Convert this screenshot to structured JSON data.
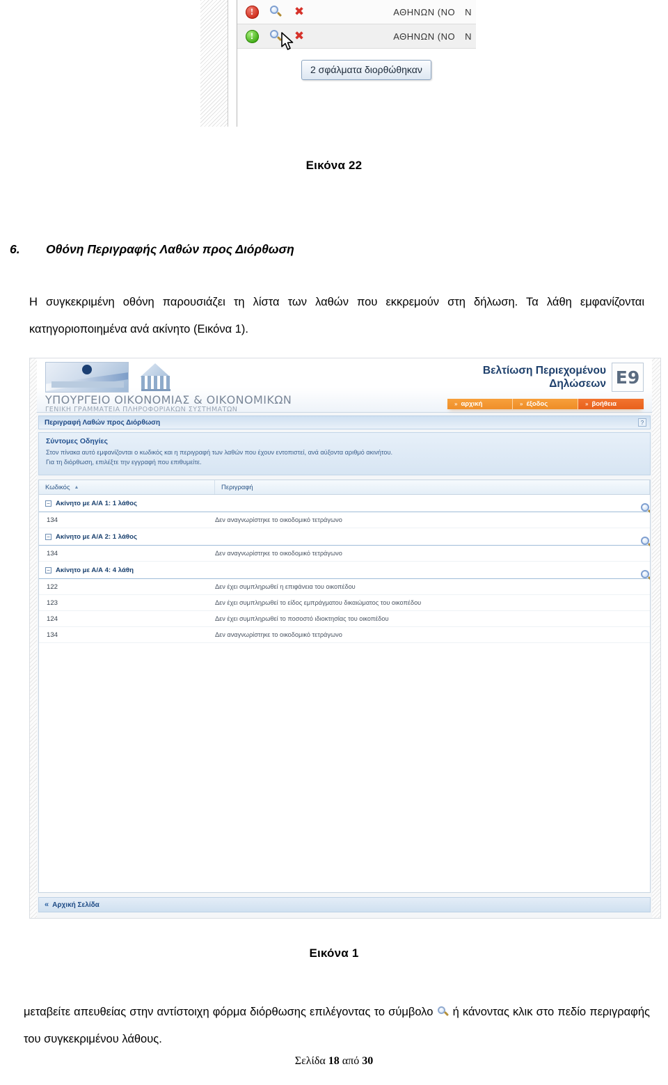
{
  "figure22": {
    "rows": [
      {
        "status_icon": "error-circle-red",
        "search_icon": "magnifier-icon",
        "delete_icon": "delete-x-icon",
        "col1": "ΑΘΗΝΩΝ (ΝΟ",
        "col2": "Ν"
      },
      {
        "status_icon": "ok-circle-green",
        "search_icon": "magnifier-icon",
        "delete_icon": "delete-x-icon",
        "col1": "ΑΘΗΝΩΝ (ΝΟ",
        "col2": "Ν"
      }
    ],
    "tooltip": "2 σφάλματα διορθώθηκαν",
    "cursor_icon": "mouse-pointer-icon"
  },
  "caption_22": "Εικόνα 22",
  "caption_1": "Εικόνα 1",
  "section": {
    "number": "6.",
    "title": "Οθόνη Περιγραφής Λαθών προς Διόρθωση"
  },
  "paragraph_1": "Η συγκεκριμένη οθόνη παρουσιάζει τη λίστα των λαθών που εκκρεμούν στη δήλωση. Τα λάθη εμφανίζονται κατηγοριοποιημένα ανά ακίνητο (Εικόνα 1).",
  "paragraph_2": {
    "before": "μεταβείτε απευθείας στην αντίστοιχη φόρμα διόρθωσης επιλέγοντας το σύμβολο",
    "after": "ή κάνοντας κλικ στο πεδίο περιγραφής του συγκεκριμένου λάθους."
  },
  "page_footer": {
    "prefix": "Σελίδα",
    "current": "18",
    "middle": "από",
    "total": "30"
  },
  "app": {
    "ministry_title": "ΥΠΟΥΡΓΕΙΟ ΟΙΚΟΝΟΜΙΑΣ & ΟΙΚΟΝΟΜΙΚΩΝ",
    "ministry_sub": "ΓΕΝΙΚΗ ΓΡΑΜΜΑΤΕΙΑ ΠΛΗΡΟΦΟΡΙΑΚΩΝ ΣΥΣΤΗΜΑΤΩΝ",
    "app_title_line1": "Βελτίωση Περιεχομένου",
    "app_title_line2": "Δηλώσεων",
    "badge": "E9",
    "nav": [
      {
        "chev": "»",
        "label": "αρχική"
      },
      {
        "chev": "»",
        "label": "έξοδος"
      },
      {
        "chev": "»",
        "label": "βοήθεια"
      }
    ],
    "page_tab_title": "Περιγραφή Λαθών προς Διόρθωση",
    "help_icon": "question-mark-icon",
    "instructions": {
      "title": "Σύντομες Οδηγίες",
      "line1": "Στον πίνακα αυτό εμφανίζονται ο κωδικός και η περιγραφή των λαθών που έχουν εντοπιστεί, ανά αύξοντα αριθμό ακινήτου.",
      "line2": "Για τη διόρθωση, επιλέξτε την εγγραφή που επιθυμείτε."
    },
    "grid": {
      "headers": [
        "Κωδικός",
        "Περιγραφή"
      ],
      "sort_indicator": "▲",
      "groups": [
        {
          "label": "Ακίνητο με Α/Α 1: 1 λάθος",
          "expander": "−",
          "magnifier_icon": "magnifier-icon",
          "rows": [
            {
              "code": "134",
              "description": "Δεν αναγνωρίστηκε το οικοδομικό τετράγωνο"
            }
          ]
        },
        {
          "label": "Ακίνητο με Α/Α 2: 1 λάθος",
          "expander": "−",
          "magnifier_icon": "magnifier-icon",
          "rows": [
            {
              "code": "134",
              "description": "Δεν αναγνωρίστηκε το οικοδομικό τετράγωνο"
            }
          ]
        },
        {
          "label": "Ακίνητο με Α/Α 4: 4 λάθη",
          "expander": "−",
          "magnifier_icon": "magnifier-icon",
          "rows": [
            {
              "code": "122",
              "description": "Δεν έχει συμπληρωθεί η επιφάνεια του οικοπέδου"
            },
            {
              "code": "123",
              "description": "Δεν έχει συμπληρωθεί το είδος εμπράγματου δικαιώματος του οικοπέδου"
            },
            {
              "code": "124",
              "description": "Δεν έχει συμπληρωθεί το ποσοστό ιδιοκτησίας του οικοπέδου"
            },
            {
              "code": "134",
              "description": "Δεν αναγνωρίστηκε το οικοδομικό τετράγωνο"
            }
          ]
        }
      ]
    },
    "footer_link": "Αρχική Σελίδα",
    "footer_icon": "double-chevron-left-icon"
  },
  "colors": {
    "accent_orange": "#ef8f2a",
    "accent_orange_dark": "#e8611c",
    "header_blue": "#1d3f6b",
    "grid_border": "#c6d4e2",
    "error_red": "#cf2e1d",
    "ok_green": "#3faa15"
  }
}
